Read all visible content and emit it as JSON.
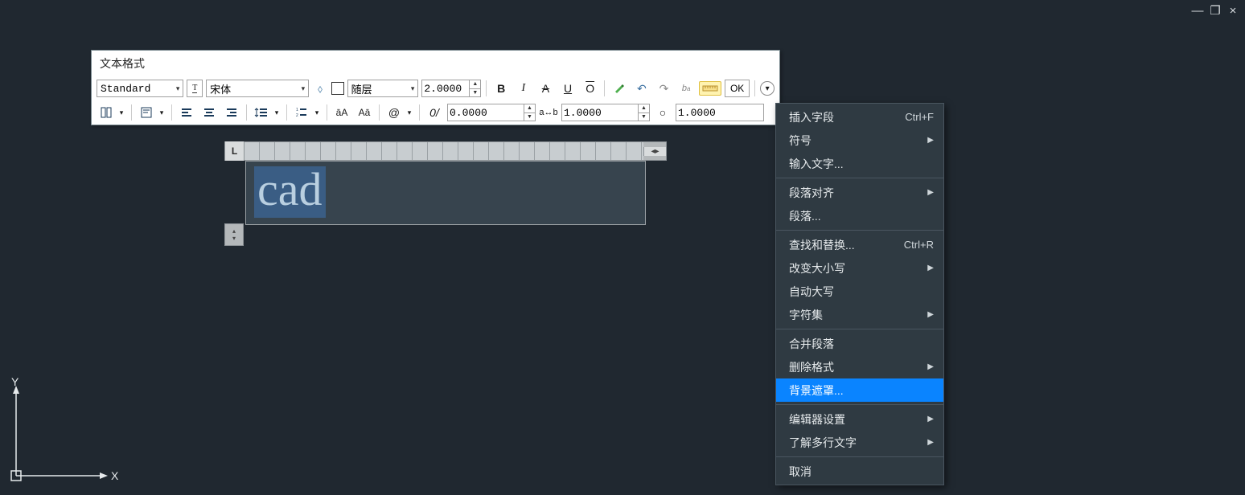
{
  "window": {
    "min": "—",
    "restore": "❐",
    "close": "×"
  },
  "panel": {
    "title": "文本格式",
    "style": "Standard",
    "font": "宋体",
    "layer": "随层",
    "height": "2.0000",
    "ok": "OK",
    "track": "0.0000",
    "width_factor": "1.0000",
    "oblique": "1.0000"
  },
  "editor": {
    "tab_marker": "L",
    "text": "cad"
  },
  "context_menu": {
    "items": [
      {
        "label": "插入字段",
        "shortcut": "Ctrl+F",
        "sub": false
      },
      {
        "label": "符号",
        "shortcut": "",
        "sub": true
      },
      {
        "label": "输入文字...",
        "shortcut": "",
        "sub": false
      },
      {
        "sep": true
      },
      {
        "label": "段落对齐",
        "shortcut": "",
        "sub": true
      },
      {
        "label": "段落...",
        "shortcut": "",
        "sub": false
      },
      {
        "sep": true
      },
      {
        "label": "查找和替换...",
        "shortcut": "Ctrl+R",
        "sub": false
      },
      {
        "label": "改变大小写",
        "shortcut": "",
        "sub": true
      },
      {
        "label": "自动大写",
        "shortcut": "",
        "sub": false
      },
      {
        "label": "字符集",
        "shortcut": "",
        "sub": true
      },
      {
        "sep": true
      },
      {
        "label": "合并段落",
        "shortcut": "",
        "sub": false
      },
      {
        "label": "删除格式",
        "shortcut": "",
        "sub": true
      },
      {
        "label": "背景遮罩...",
        "shortcut": "",
        "sub": false,
        "hl": true
      },
      {
        "sep": true
      },
      {
        "label": "编辑器设置",
        "shortcut": "",
        "sub": true
      },
      {
        "label": "了解多行文字",
        "shortcut": "",
        "sub": true
      },
      {
        "sep": true
      },
      {
        "label": "取消",
        "shortcut": "",
        "sub": false
      }
    ]
  },
  "ucs": {
    "x": "X",
    "y": "Y"
  }
}
